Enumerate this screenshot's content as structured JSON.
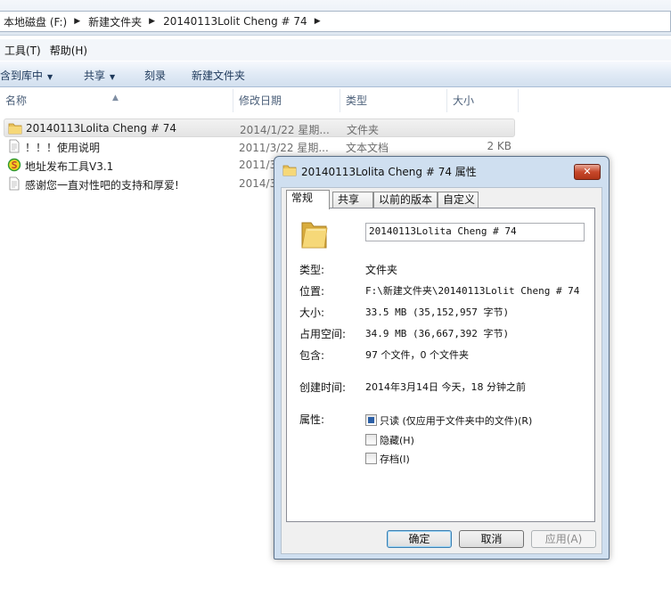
{
  "address": {
    "crumbs": [
      "本地磁盘 (F:)",
      "新建文件夹",
      "20140113Lolit Cheng # 74"
    ]
  },
  "menu": {
    "items": [
      "工具(T)",
      "帮助(H)"
    ]
  },
  "toolbar": {
    "include_library": "包含到库中",
    "share": "共享",
    "burn": "刻录",
    "new_folder": "新建文件夹"
  },
  "columns": {
    "name": "名称",
    "modified": "修改日期",
    "type": "类型",
    "size": "大小"
  },
  "files": [
    {
      "name": "20140113Lolita Cheng # 74",
      "modified": "2014/1/22 星期...",
      "type": "文件夹",
      "size": "",
      "icon": "folder-icon"
    },
    {
      "name": "！！！使用说明",
      "modified": "2011/3/22 星期...",
      "type": "文本文档",
      "size": "2 KB",
      "icon": "text-file-icon"
    },
    {
      "name": "地址发布工具V3.1",
      "modified": "2011/3",
      "type": "",
      "size": "",
      "icon": "app-icon"
    },
    {
      "name": "感谢您一直对性吧的支持和厚爱!",
      "modified": "2014/3",
      "type": "",
      "size": "",
      "icon": "text-file-icon"
    }
  ],
  "dialog": {
    "title": "20140113Lolita Cheng # 74 属性",
    "close": "✕",
    "tabs": [
      "常规",
      "共享",
      "以前的版本",
      "自定义"
    ],
    "folder_name": "20140113Lolita Cheng # 74",
    "type_label": "类型:",
    "type_value": "文件夹",
    "location_label": "位置:",
    "location_value": "F:\\新建文件夹\\20140113Lolit Cheng # 74",
    "size_label": "大小:",
    "size_value": "33.5 MB (35,152,957 字节)",
    "disk_label": "占用空间:",
    "disk_value": "34.9 MB (36,667,392 字节)",
    "contains_label": "包含:",
    "contains_value": "97 个文件，0 个文件夹",
    "created_label": "创建时间:",
    "created_value": "2014年3月14日 今天，18 分钟之前",
    "attrs_label": "属性:",
    "attr_readonly": "只读 (仅应用于文件夹中的文件)(R)",
    "attr_hidden": "隐藏(H)",
    "attr_archive": "存档(I)",
    "ok": "确定",
    "cancel": "取消",
    "apply": "应用(A)"
  }
}
